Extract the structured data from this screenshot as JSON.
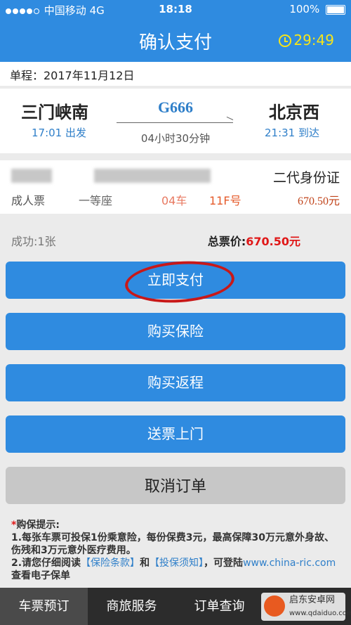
{
  "status_bar": {
    "carrier": "中国移动",
    "network": "4G",
    "time": "18:18",
    "battery": "100%"
  },
  "nav": {
    "title": "确认支付",
    "countdown": "29:49"
  },
  "itinerary": {
    "date_label": "单程：2017年11月12日"
  },
  "trip": {
    "from_station": "三门峡南",
    "to_station": "北京西",
    "train_no": "G666",
    "depart": "17:01 出发",
    "arrive": "21:31 到达",
    "duration": "04小时30分钟"
  },
  "passenger": {
    "id_type": "二代身份证",
    "ticket_type": "成人票",
    "seat_class": "一等座",
    "car_no": "04车",
    "seat_no": "11F号",
    "price": "670.50元"
  },
  "summary": {
    "success": "成功:1张",
    "total_label": "总票价:",
    "total_value": "670.50元"
  },
  "buttons": {
    "pay_now": "立即支付",
    "buy_insurance": "购买保险",
    "buy_return": "购买返程",
    "ticket_delivery": "送票上门",
    "cancel_order": "取消订单"
  },
  "notice": {
    "star": "*",
    "title": "购保提示:",
    "line1": "1.每张车票可投保1份乘意险，每份保费3元，最高保障30万元意外身故、伤残和3万元意外医疗费用。",
    "line2_prefix": "2.请您仔细阅读",
    "link1": "【保险条款】",
    "and": "和",
    "link2": "【投保须知】",
    "line2_suffix": "，可登陆",
    "url": "www.china-ric.com",
    "line2_end": "查看电子保单"
  },
  "tabbar": {
    "tabs": [
      "车票预订",
      "商旅服务",
      "订单查询"
    ]
  },
  "watermark": {
    "name": "启东安卓网",
    "url": "www.qdaiduo.com"
  },
  "colors": {
    "primary": "#2f8be0",
    "price": "#c1441b",
    "total": "#e01818",
    "countdown": "#f6e51a"
  }
}
